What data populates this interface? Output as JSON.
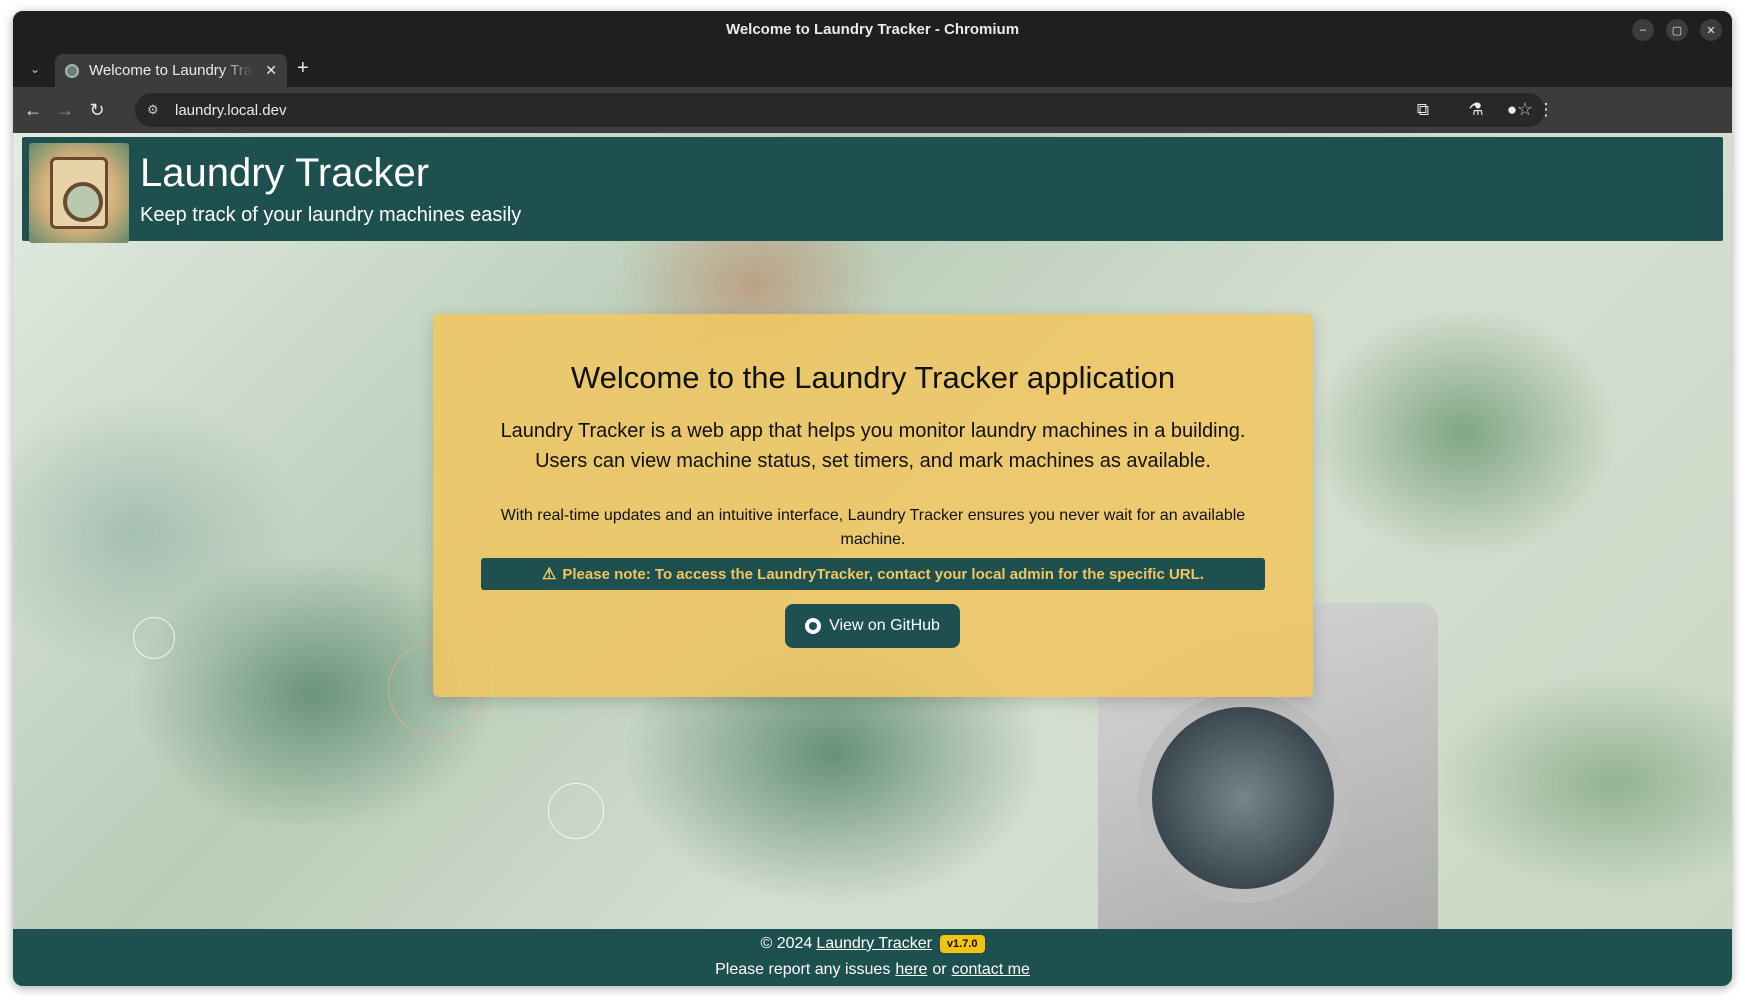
{
  "window": {
    "title": "Welcome to Laundry Tracker - Chromium",
    "controls": [
      "minimize-icon",
      "maximize-icon",
      "close-icon"
    ]
  },
  "tabs": [
    {
      "title": "Welcome to Laundry Tracker",
      "close": "✕"
    }
  ],
  "toolbar": {
    "url": "laundry.local.dev",
    "new_tab": "+"
  },
  "header": {
    "title": "Laundry Tracker",
    "subtitle": "Keep track of your laundry machines easily"
  },
  "card": {
    "title": "Welcome to the Laundry Tracker application",
    "lead": "Laundry Tracker is a web app that helps you monitor laundry machines in a building. Users can view machine status, set timers, and mark machines as available.",
    "text": "With real-time updates and an intuitive interface, Laundry Tracker ensures you never wait for an available machine.",
    "note": "Please note: To access the LaundryTracker, contact your local admin for the specific URL.",
    "button": "View on GitHub"
  },
  "footer": {
    "copyright": "© 2024",
    "app_link": "Laundry Tracker",
    "version": "v1.7.0",
    "report_prefix": "Please report any issues",
    "here_link": "here",
    "or": "or",
    "contact_link": "contact me"
  },
  "colors": {
    "brand": "#1f5050",
    "card": "#f1c660",
    "badge": "#f1c40f"
  }
}
